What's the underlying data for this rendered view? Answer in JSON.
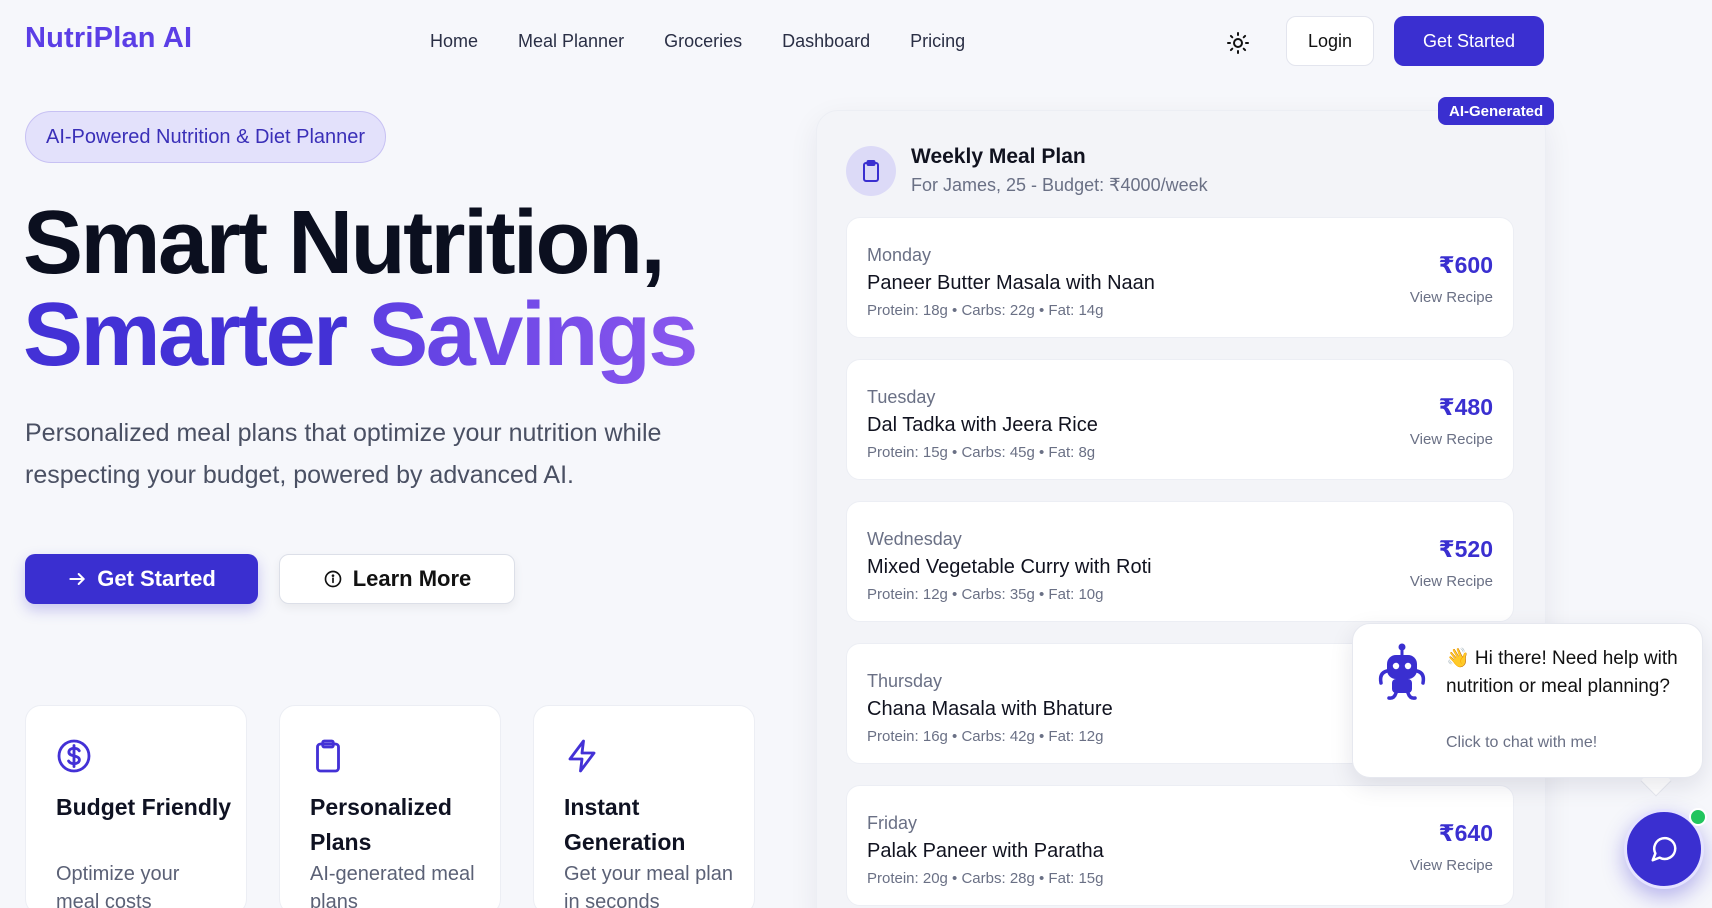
{
  "nav": {
    "logo": "NutriPlan AI",
    "links": [
      "Home",
      "Meal Planner",
      "Groceries",
      "Dashboard",
      "Pricing"
    ],
    "login": "Login",
    "get_started": "Get Started",
    "theme_icon": "sun-icon"
  },
  "hero": {
    "pill": "AI-Powered Nutrition & Diet Planner",
    "title_line1": "Smart Nutrition,",
    "title_word1": "Smarter",
    "title_word2": "Savings",
    "lead": "Personalized meal plans that optimize your nutrition while respecting your budget, powered by advanced AI.",
    "primary_cta": "Get Started",
    "secondary_cta": "Learn More"
  },
  "features": [
    {
      "icon": "dollar-circle-icon",
      "title": "Budget Friendly",
      "desc": "Optimize your meal costs"
    },
    {
      "icon": "clipboard-icon",
      "title": "Personalized Plans",
      "desc": "AI-generated meal plans"
    },
    {
      "icon": "lightning-icon",
      "title": "Instant Generation",
      "desc": "Get your meal plan in seconds"
    }
  ],
  "plan": {
    "badge": "AI-Generated",
    "title": "Weekly Meal Plan",
    "subtitle": "For James, 25 - Budget: ₹4000/week",
    "days": [
      {
        "day": "Monday",
        "dish": "Paneer Butter Masala with Naan",
        "macros": "Protein: 18g • Carbs: 22g • Fat: 14g",
        "price": "₹600",
        "link": "View Recipe"
      },
      {
        "day": "Tuesday",
        "dish": "Dal Tadka with Jeera Rice",
        "macros": "Protein: 15g • Carbs: 45g • Fat: 8g",
        "price": "₹480",
        "link": "View Recipe"
      },
      {
        "day": "Wednesday",
        "dish": "Mixed Vegetable Curry with Roti",
        "macros": "Protein: 12g • Carbs: 35g • Fat: 10g",
        "price": "₹520",
        "link": "View Recipe"
      },
      {
        "day": "Thursday",
        "dish": "Chana Masala with Bhature",
        "macros": "Protein: 16g • Carbs: 42g • Fat: 12g",
        "price": "",
        "link": ""
      },
      {
        "day": "Friday",
        "dish": "Palak Paneer with Paratha",
        "macros": "Protein: 20g • Carbs: 28g • Fat: 15g",
        "price": "₹640",
        "link": "View Recipe"
      }
    ]
  },
  "chat": {
    "message": "👋 Hi there! Need help with nutrition or meal planning?",
    "sub": "Click to chat with me!"
  },
  "colors": {
    "brand": "#3a2fd0",
    "accent": "#8a57ee",
    "online": "#22c55e"
  }
}
